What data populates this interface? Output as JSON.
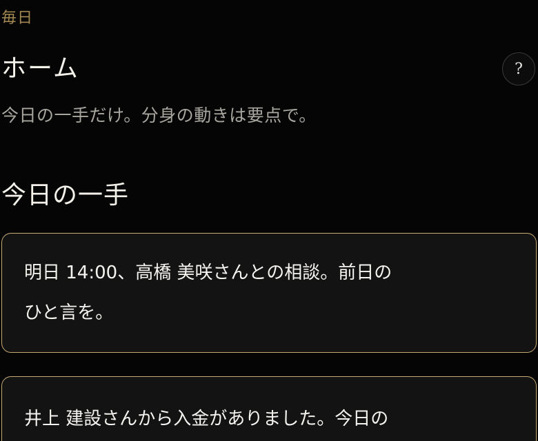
{
  "header": {
    "eyebrow": "毎日",
    "title": "ホーム",
    "help_label": "?",
    "subtitle": "今日の一手だけ。分身の動きは要点で。"
  },
  "section": {
    "heading": "今日の一手"
  },
  "cards": [
    {
      "line1": "明日 14:00、高橋 美咲さんとの相談。前日の",
      "line2": "ひと言を。"
    },
    {
      "line1": "井上 建設さんから入金がありました。今日の"
    }
  ],
  "colors": {
    "background": "#050505",
    "accent_gold": "#c9ac72",
    "eyebrow_gold": "#a48a52",
    "muted_text": "#a9a6a0"
  },
  "icons": {
    "help": "question-mark-icon"
  }
}
